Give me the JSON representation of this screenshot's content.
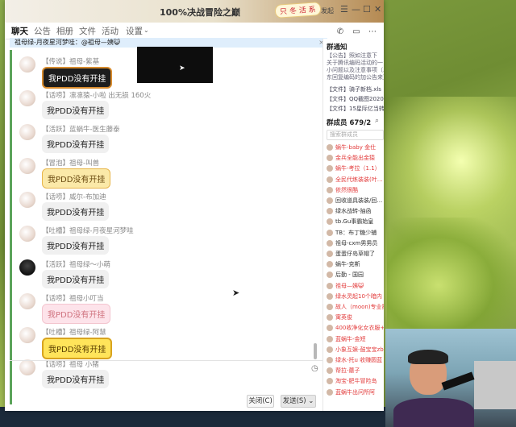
{
  "window": {
    "title": "100%决战冒险之巅",
    "banner": "只 冬 活 系",
    "controls": [
      "发起",
      "☰",
      "—",
      "☐",
      "✕"
    ]
  },
  "tabs": [
    {
      "label": "聊天",
      "active": true
    },
    {
      "label": "公告",
      "active": false
    },
    {
      "label": "相册",
      "active": false
    },
    {
      "label": "文件",
      "active": false
    },
    {
      "label": "活动",
      "active": false
    },
    {
      "label": "设置",
      "active": false
    }
  ],
  "tab_icons": [
    "phone-icon",
    "share-icon",
    "more-icon"
  ],
  "pinned": {
    "text": "祖母绿-月夜星河梦哇：@祖母—姨😺",
    "close": "×"
  },
  "messages": [
    {
      "sender": "【传说】祖母-紫基",
      "text": "我PDD没有开挂",
      "style": "dark"
    },
    {
      "sender": "【话唠】凛凛猿-小啦 出无损 160火",
      "text": "我PDD没有开挂",
      "style": "plain"
    },
    {
      "sender": "【活跃】蓝蜗牛-医生藤泰",
      "text": "我PDD没有开挂",
      "style": "plain"
    },
    {
      "sender": "【冒泡】祖母-叫兽",
      "text": "我PDD没有开挂",
      "style": "gold"
    },
    {
      "sender": "【话唠】威尔-布加迪",
      "text": "我PDD没有开挂",
      "style": "plain"
    },
    {
      "sender": "【吐槽】祖母绿-月夜星河梦哇",
      "text": "我PDD没有开挂",
      "style": "plain"
    },
    {
      "sender": "【活跃】祖母绿～小萌",
      "text": "我PDD没有开挂",
      "style": "plain"
    },
    {
      "sender": "【话唠】祖母小叮当",
      "text": "我PDD没有开挂",
      "style": "pink"
    },
    {
      "sender": "【吐槽】祖母绿-阿慧",
      "text": "我PDD没有开挂",
      "style": "yellow"
    },
    {
      "sender": "【话唠】祖母 小猪",
      "text": "我PDD没有开挂",
      "style": "plain"
    }
  ],
  "input": {
    "close_label": "关闭(C)",
    "send_label": "发送(S)"
  },
  "right_panel": {
    "notice_title": "群通知",
    "notice_lines": [
      "【公告】照如注意下",
      "关于腾讯编码活动的一",
      "小问题以及注意事项（乌",
      "东回复编码的加公告来）"
    ],
    "files": [
      "【文件】骑子新档.xls",
      "【文件】QQ截图202002…",
      "【文件】15星际亿当转暴…"
    ],
    "members_title": "群成员 679/2",
    "search_placeholder": "搜索群成员",
    "members": [
      {
        "name": "蜗牛-baby 金仕",
        "color": "#e23a3a"
      },
      {
        "name": "金兵全能出金猿",
        "color": "#e23a3a"
      },
      {
        "name": "蜗牛-考拉（1.1）",
        "color": "#e23a3a"
      },
      {
        "name": "全民代练装装(叶…",
        "color": "#e23a3a"
      },
      {
        "name": "依然很酷",
        "color": "#e23a3a"
      },
      {
        "name": "回收道具装装/回…",
        "color": "#333333"
      },
      {
        "name": "绿水战转-抽函",
        "color": "#333333"
      },
      {
        "name": "tb.Gu事霸始皇",
        "color": "#333333"
      },
      {
        "name": "TB：布丁糖少辅",
        "color": "#333333"
      },
      {
        "name": "祖母-cxm男男员",
        "color": "#333333"
      },
      {
        "name": "蛋蛋仔岛草帽了",
        "color": "#333333"
      },
      {
        "name": "蜗牛-克斯",
        "color": "#333333"
      },
      {
        "name": "后勤 - 国园",
        "color": "#333333"
      },
      {
        "name": "祖母—姨😺",
        "color": "#e23a3a"
      },
      {
        "name": "绿水灵起10个暗内",
        "color": "#e23a3a"
      },
      {
        "name": "故人（moon)专业拉…",
        "color": "#e23a3a"
      },
      {
        "name": "寓英俊",
        "color": "#e23a3a"
      },
      {
        "name": "400收净化女衣服+收",
        "color": "#e23a3a"
      },
      {
        "name": "蓝蜗牛-金短",
        "color": "#e23a3a"
      },
      {
        "name": "小象互娱-鼓宝宝zbb",
        "color": "#e23a3a"
      },
      {
        "name": "绿水-托u 收赚圆蓝",
        "color": "#e23a3a"
      },
      {
        "name": "帮拉-蘑子",
        "color": "#e23a3a"
      },
      {
        "name": "淘宝-肥牛冒险岛",
        "color": "#e23a3a"
      },
      {
        "name": "蓝蜗牛出问所阿",
        "color": "#e23a3a"
      }
    ]
  }
}
